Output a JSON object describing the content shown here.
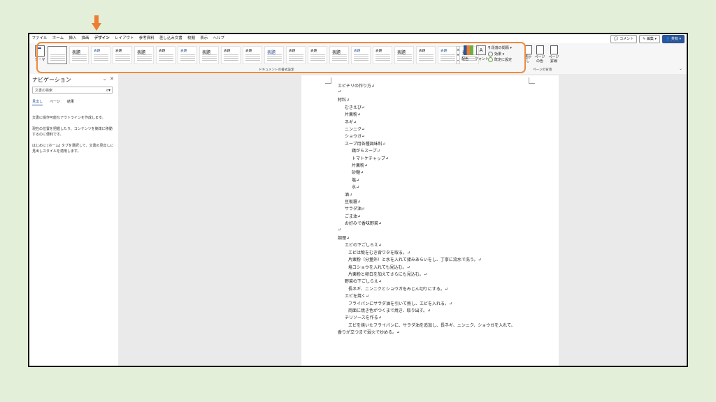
{
  "menu_tabs": [
    "ファイル",
    "ホーム",
    "挿入",
    "描画",
    "デザイン",
    "レイアウト",
    "参考資料",
    "差し込み文書",
    "校閲",
    "表示",
    "ヘルプ"
  ],
  "active_tab_index": 4,
  "right_buttons": {
    "comment": "コメント",
    "edit": "編集",
    "share": "共有"
  },
  "ribbon": {
    "theme_label": "テーマ",
    "style_titles": [
      "",
      "表題",
      "表題",
      "表題",
      "表題",
      "表題",
      "表題",
      "表題",
      "表題",
      "表題",
      "表題",
      "表題",
      "表題",
      "表題",
      "表題",
      "表題",
      "表題",
      "表題",
      "表題",
      "表題"
    ],
    "colors_label": "配色",
    "fonts_label": "フォント",
    "paragraph_spacing": "段落の間隔",
    "effects": "効果",
    "set_default": "既定に設定",
    "page_buttons": [
      "透かし",
      "ページの色",
      "ページ罫線"
    ],
    "group_doc_format": "ドキュメントの書式設定",
    "group_page_bg": "ページの背景"
  },
  "nav": {
    "title": "ナビゲーション",
    "search_placeholder": "文書の検索",
    "tabs": [
      "見出し",
      "ページ",
      "結果"
    ],
    "text": [
      "文書に操作可能なアウトラインを作成します。",
      "現在の位置を把握したり、コンテンツを簡単に移動するのに便利です。",
      "はじめに [ホーム] タブを選択して、文書の見出しに見出しスタイルを適用します。"
    ]
  },
  "doc_lines": [
    {
      "t": "エビチリの作り方↵",
      "i": 0
    },
    {
      "t": "↵",
      "i": 0
    },
    {
      "t": "材料↵",
      "i": 0
    },
    {
      "t": "むきえび↵",
      "i": 1
    },
    {
      "t": "片栗粉↵",
      "i": 1
    },
    {
      "t": "ネギ↵",
      "i": 1
    },
    {
      "t": "ニンニク↵",
      "i": 1
    },
    {
      "t": "ショウガ↵",
      "i": 1
    },
    {
      "t": "スープ用各種調味料↵",
      "i": 1
    },
    {
      "t": "鶏がらスープ↵",
      "i": 2
    },
    {
      "t": "トマトケチャップ↵",
      "i": 2
    },
    {
      "t": "片栗粉↵",
      "i": 2
    },
    {
      "t": "砂糖↵",
      "i": 2
    },
    {
      "t": "塩↵",
      "i": 2
    },
    {
      "t": "水↵",
      "i": 2
    },
    {
      "t": "酒↵",
      "i": 1
    },
    {
      "t": "豆板醤↵",
      "i": 1
    },
    {
      "t": "サラダ油↵",
      "i": 1
    },
    {
      "t": "ごま油↵",
      "i": 1
    },
    {
      "t": "お好みで香味野菜↵",
      "i": 1
    },
    {
      "t": "↵",
      "i": 0
    },
    {
      "t": "調理↵",
      "i": 0
    },
    {
      "t": "エビの下ごしらえ↵",
      "i": 1
    },
    {
      "t": "エビは殻をむき背ワタを取る。↵",
      "i": 1.5
    },
    {
      "t": "片栗粉（分量外）と水を入れて揉みあらいをし、丁寧に流水で洗う。↵",
      "i": 1.5
    },
    {
      "t": "塩コショウを入れても見込む。↵",
      "i": 1.5
    },
    {
      "t": "片栗粉と卵白を加えてさらにも見込む。↵",
      "i": 1.5
    },
    {
      "t": "野菜の下ごしらえ↵",
      "i": 1
    },
    {
      "t": "長ネギ、ニンニクとショウガをみじん切りにする。↵",
      "i": 1.5
    },
    {
      "t": "エビを焼く↵",
      "i": 1
    },
    {
      "t": "フライパンにサラダ油を引いて熱し、エビを入れる。↵",
      "i": 1.5
    },
    {
      "t": "両面に焼き色がつくまで焼き、取り出す。↵",
      "i": 1.5
    },
    {
      "t": "チリソースを作る↵",
      "i": 1
    },
    {
      "t": "エビを焼いたフライパンに、サラダ油を追加し、長ネギ、ニンニク、ショウガを入れて、",
      "i": 1.5
    },
    {
      "t": "香りが立つまで弱火で炒める。↵",
      "i": 0
    }
  ],
  "colors": {
    "accent": "#2b579a",
    "highlight": "#f08a3c",
    "arrow": "#ed7d31",
    "background": "#e3efd9"
  }
}
